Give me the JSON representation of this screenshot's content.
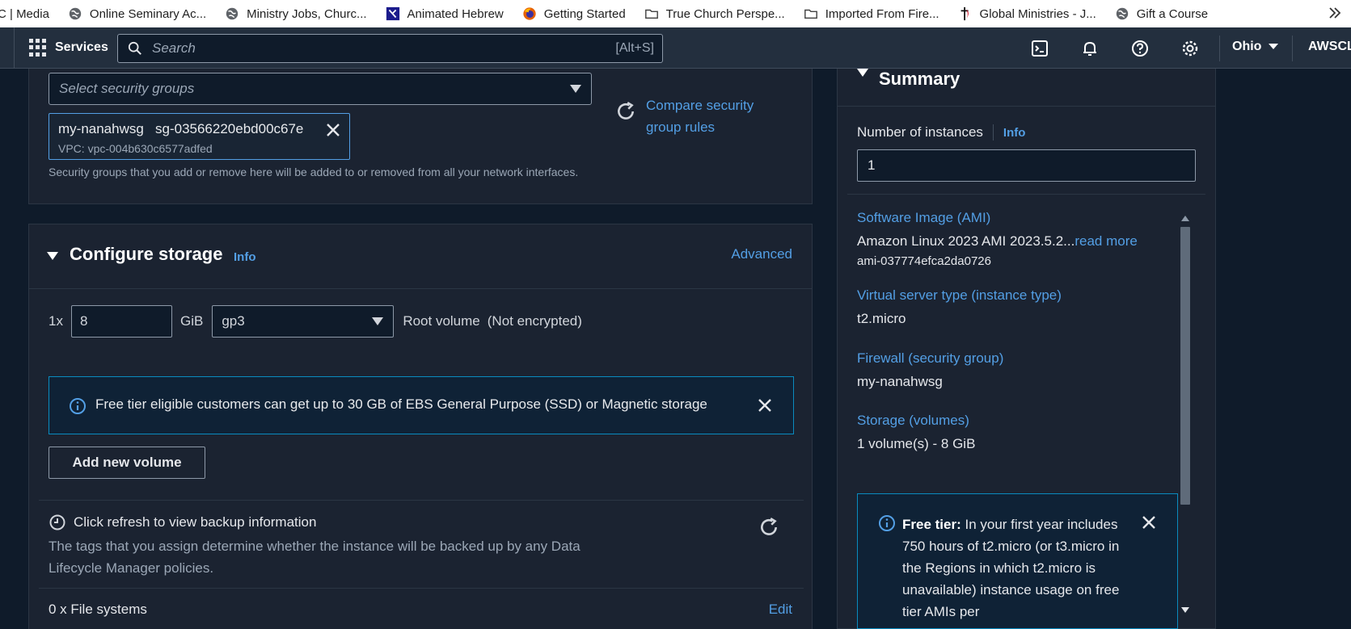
{
  "bookmarks": [
    {
      "label": "C | Media",
      "icon": "page-icon"
    },
    {
      "label": "Online Seminary Ac...",
      "icon": "globe-icon"
    },
    {
      "label": "Ministry Jobs, Churc...",
      "icon": "globe-icon"
    },
    {
      "label": "Animated Hebrew",
      "icon": "hebrew-letter-icon"
    },
    {
      "label": "Getting Started",
      "icon": "firefox-icon"
    },
    {
      "label": "True Church Perspe...",
      "icon": "folder-icon"
    },
    {
      "label": "Imported From Fire...",
      "icon": "folder-icon"
    },
    {
      "label": "Global Ministries - J...",
      "icon": "cross-flame-icon"
    },
    {
      "label": "Gift a Course",
      "icon": "globe-icon"
    }
  ],
  "nav": {
    "services": "Services",
    "search_placeholder": "Search",
    "search_shortcut": "[Alt+S]",
    "region": "Ohio",
    "account": "AWSCLI"
  },
  "security": {
    "select_placeholder": "Select security groups",
    "token_name": "my-nanahwsg",
    "token_id": "sg-03566220ebd00c67e",
    "token_vpc": "VPC: vpc-004b630c6577adfed",
    "compare_link": "Compare security group rules",
    "hint": "Security groups that you add or remove here will be added to or removed from all your network interfaces."
  },
  "storage": {
    "title": "Configure storage",
    "info": "Info",
    "advanced": "Advanced",
    "multiplier": "1x",
    "size": "8",
    "unit": "GiB",
    "volume_type": "gp3",
    "root_label": "Root volume",
    "encryption": "(Not encrypted)",
    "alert": "Free tier eligible customers can get up to 30 GB of EBS General Purpose (SSD) or Magnetic storage",
    "add_volume": "Add new volume",
    "backup_title": "Click refresh to view backup information",
    "backup_desc": "The tags that you assign determine whether the instance will be backed up by any Data Lifecycle Manager policies.",
    "file_systems": "0 x File systems",
    "edit": "Edit"
  },
  "summary": {
    "title": "Summary",
    "num_instances_label": "Number of instances",
    "info": "Info",
    "num_instances": "1",
    "ami_label": "Software Image (AMI)",
    "ami_value": "Amazon Linux 2023 AMI 2023.5.2...",
    "read_more": "read more",
    "ami_id": "ami-037774efca2da0726",
    "instance_type_label": "Virtual server type (instance type)",
    "instance_type": "t2.micro",
    "firewall_label": "Firewall (security group)",
    "firewall": "my-nanahwsg",
    "storage_label": "Storage (volumes)",
    "storage": "1 volume(s) - 8 GiB",
    "free_tier_bold": "Free tier:",
    "free_tier_text": " In your first year includes 750 hours of t2.micro (or t3.micro in the Regions in which t2.micro is unavailable) instance usage on free tier AMIs per"
  },
  "colors": {
    "link": "#539fe5",
    "alert_border": "#0a8bbf",
    "nav_bg": "#232f3e",
    "page_bg": "#0f1b2a"
  }
}
